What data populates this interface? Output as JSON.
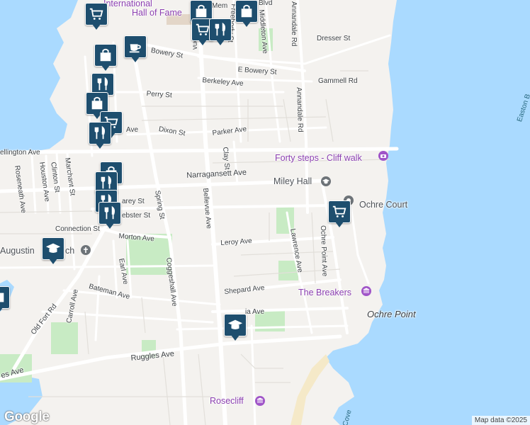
{
  "streets": {
    "bellevue_ave": "Bellevue Ave",
    "bellevue_ave_top": "vue Ave",
    "narragansett_ave": "Narragansett Ave",
    "spring_st": "Spring St",
    "coggeshall_ave": "Coggeshall Ave",
    "ruggles_ave": "Ruggles Ave",
    "ruggles_ave_left": "es Ave",
    "annandale_rd_top": "Annandale Rd",
    "annandale_rd_mid": "Annandale Rd",
    "dresser_st": "Dresser St",
    "gammell_rd": "Gammell Rd",
    "e_bowery_st": "E Bowery St",
    "bowery_st": "Bowery St",
    "berkeley_ave": "Berkeley Ave",
    "perry_st": "Perry St",
    "parker_ave": "Parker Ave",
    "ave_stub": "Ave",
    "dixon_st": "Dixon St",
    "clay_st": "Clay St",
    "wellington_ave": "ellington Ave",
    "roseneath_ave": "Roseneath Ave",
    "clinton_st": "Clinton St",
    "houston_ave": "Houston Ave",
    "marchant_st": "Marchant St",
    "carey_st": "arey St",
    "webster_st": "ebster St",
    "connection_st": "Connection St",
    "morton_ave": "Morton Ave",
    "leroy_ave": "Leroy Ave",
    "lawrence_ave": "Lawrence Ave",
    "ochre_point_ave": "Ochre Point Ave",
    "shepard_ave": "Shepard Ave",
    "earl_ave": "Earl Ave",
    "bateman_ave": "Bateman Ave",
    "carroll_ave": "Carroll Ave",
    "old_fort_rd": "Old Fort Rd",
    "middleton_ave": "Middleton Ave",
    "freebody_st": "Freebody St",
    "memorial_blvd": "Blvd",
    "memorial_blvd_left": "Mem",
    "victoria_ave": "ia Ave"
  },
  "places": {
    "forty_steps": "Forty steps - Cliff walk",
    "miley_hall": "Miley Hall",
    "ochre_court": "Ochre Court",
    "the_breakers": "The Breakers",
    "ochre_point": "Ochre Point",
    "rosecliff": "Rosecliff",
    "augustin": "Augustin",
    "augustin_suffix": "ch",
    "hall_of_fame_1": "International",
    "hall_of_fame_2": "Hall of Fame",
    "easton_bay": "Easton B",
    "cove": "Cove"
  },
  "branding": {
    "logo": "Google",
    "attribution": "Map data ©2025"
  },
  "colors": {
    "water": "#aadaff",
    "land": "#f4f2ef",
    "park": "#c8ebc4",
    "road": "#ffffff",
    "road_outline": "#dcdcdc",
    "poi_purple": "#8b3fb0",
    "marker": "#1e4e6e"
  },
  "markers": [
    {
      "name": "shopping-cart-marker-1",
      "icon": "cart"
    },
    {
      "name": "shopping-bag-marker-1",
      "icon": "bag"
    },
    {
      "name": "shopping-bag-marker-2",
      "icon": "bag"
    },
    {
      "name": "shopping-bag-marker-3",
      "icon": "bag"
    },
    {
      "name": "coffee-marker",
      "icon": "coffee"
    },
    {
      "name": "restaurant-marker-1",
      "icon": "fork-knife"
    },
    {
      "name": "restaurant-marker-2",
      "icon": "fork-knife"
    },
    {
      "name": "restaurant-marker-3",
      "icon": "fork-knife"
    },
    {
      "name": "restaurant-marker-4",
      "icon": "fork-knife"
    },
    {
      "name": "restaurant-marker-5",
      "icon": "fork-knife"
    },
    {
      "name": "restaurant-marker-6",
      "icon": "fork-knife"
    },
    {
      "name": "shopping-cart-marker-2",
      "icon": "cart"
    },
    {
      "name": "shopping-cart-marker-3",
      "icon": "cart"
    },
    {
      "name": "shopping-cart-marker-ochre",
      "icon": "cart"
    },
    {
      "name": "school-marker-1",
      "icon": "graduation-cap"
    },
    {
      "name": "school-marker-2",
      "icon": "graduation-cap"
    }
  ]
}
